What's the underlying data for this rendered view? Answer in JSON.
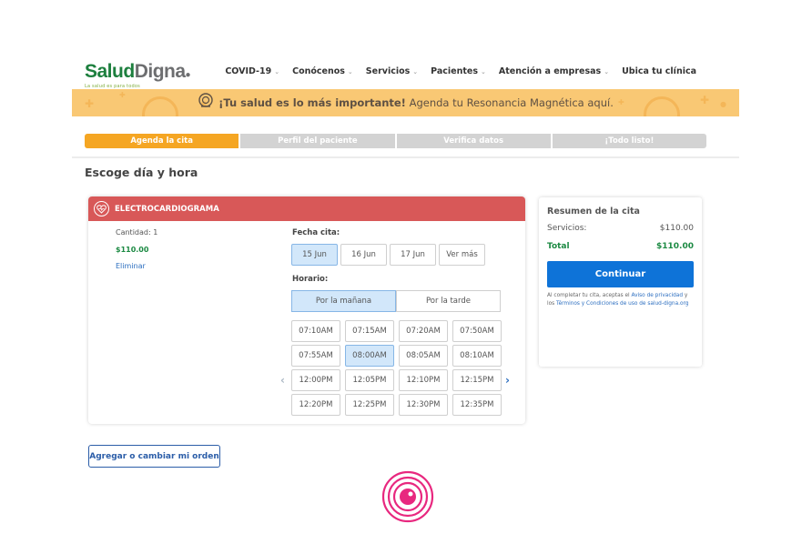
{
  "brand": {
    "name_part1": "Salud",
    "name_part2": "Digna",
    "tagline": "La salud es para todos"
  },
  "nav": [
    {
      "label": "COVID-19",
      "has_dropdown": true
    },
    {
      "label": "Conócenos",
      "has_dropdown": true
    },
    {
      "label": "Servicios",
      "has_dropdown": true
    },
    {
      "label": "Pacientes",
      "has_dropdown": true
    },
    {
      "label": "Atención a empresas",
      "has_dropdown": true
    },
    {
      "label": "Ubica tu clínica",
      "has_dropdown": false
    }
  ],
  "banner": {
    "text_bold": "¡Tu salud es lo más importante!",
    "text_rest": " Agenda tu Resonancia Magnética aquí."
  },
  "steps": [
    {
      "label": "Agenda la cita",
      "active": true
    },
    {
      "label": "Perfil del paciente",
      "active": false
    },
    {
      "label": "Verifica datos",
      "active": false
    },
    {
      "label": "¡Todo listo!",
      "active": false
    }
  ],
  "page_title": "Escoge día y hora",
  "service": {
    "name": "ELECTROCARDIOGRAMA",
    "quantity_label": "Cantidad: 1",
    "price": "$110.00",
    "remove_label": "Eliminar"
  },
  "appointment": {
    "date_label": "Fecha cita:",
    "dates": [
      {
        "label": "15 Jun",
        "selected": true
      },
      {
        "label": "16 Jun",
        "selected": false
      },
      {
        "label": "17 Jun",
        "selected": false
      },
      {
        "label": "Ver más",
        "selected": false
      }
    ],
    "schedule_label": "Horario:",
    "shifts": [
      {
        "label": "Por la mañana",
        "selected": true
      },
      {
        "label": "Por la tarde",
        "selected": false
      }
    ],
    "times": [
      {
        "label": "07:10AM",
        "selected": false
      },
      {
        "label": "07:15AM",
        "selected": false
      },
      {
        "label": "07:20AM",
        "selected": false
      },
      {
        "label": "07:50AM",
        "selected": false
      },
      {
        "label": "07:55AM",
        "selected": false
      },
      {
        "label": "08:00AM",
        "selected": true
      },
      {
        "label": "08:05AM",
        "selected": false
      },
      {
        "label": "08:10AM",
        "selected": false
      },
      {
        "label": "12:00PM",
        "selected": false
      },
      {
        "label": "12:05PM",
        "selected": false
      },
      {
        "label": "12:10PM",
        "selected": false
      },
      {
        "label": "12:15PM",
        "selected": false
      },
      {
        "label": "12:20PM",
        "selected": false
      },
      {
        "label": "12:25PM",
        "selected": false
      },
      {
        "label": "12:30PM",
        "selected": false
      },
      {
        "label": "12:35PM",
        "selected": false
      }
    ],
    "prev_arrow": "‹",
    "next_arrow": "›"
  },
  "summary": {
    "title": "Resumen de la cita",
    "services_label": "Servicios:",
    "services_value": "$110.00",
    "total_label": "Total",
    "total_value": "$110.00",
    "continue_label": "Continuar",
    "legal_prefix": "Al completar tu cita, aceptas el ",
    "legal_link1": "Aviso de privacidad",
    "legal_mid": " y los ",
    "legal_link2": "Términos y Condiciones de uso de salud-digna.org"
  },
  "order_button": "Agregar o cambiar mi orden",
  "colors": {
    "brand_green": "#1d7f3e",
    "banner": "#f9c874",
    "step_active": "#f5a623",
    "service_header": "#d85858",
    "primary": "#0e73d8",
    "selected_bg": "#d2e7fa",
    "spinner": "#e8287f"
  },
  "icons": {
    "banner": "mri-icon",
    "service": "heart-icon",
    "loading": "loading-spinner-icon"
  }
}
